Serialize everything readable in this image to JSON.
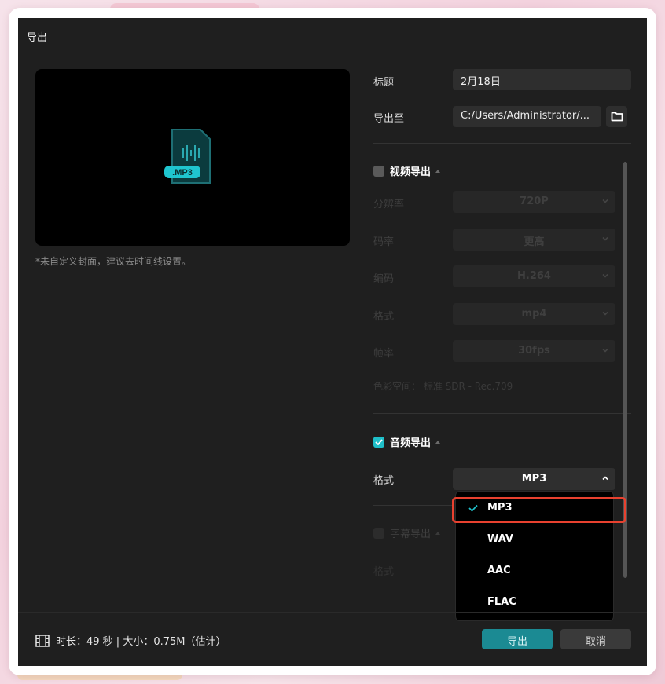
{
  "dialog": {
    "title": "导出"
  },
  "preview": {
    "file_badge": ".MP3",
    "cover_hint": "*未自定义封面，建议去时间线设置。"
  },
  "title_row": {
    "label": "标题",
    "value": "2月18日"
  },
  "export_to_row": {
    "label": "导出至",
    "value": "C:/Users/Administrator/..."
  },
  "video_export": {
    "title": "视频导出",
    "checked": false,
    "rows": [
      {
        "label": "分辨率",
        "value": "720P"
      },
      {
        "label": "码率",
        "value": "更高"
      },
      {
        "label": "编码",
        "value": "H.264"
      },
      {
        "label": "格式",
        "value": "mp4"
      },
      {
        "label": "帧率",
        "value": "30fps"
      }
    ],
    "color_space": "色彩空间：  标准 SDR - Rec.709"
  },
  "audio_export": {
    "title": "音频导出",
    "checked": true,
    "format_label": "格式",
    "format_value": "MP3"
  },
  "subtitle_export": {
    "title": "字幕导出",
    "checked": false,
    "format_label": "格式"
  },
  "format_dropdown": {
    "options": [
      "MP3",
      "WAV",
      "AAC",
      "FLAC"
    ],
    "selected": "MP3"
  },
  "footer": {
    "info": "时长：49 秒 | 大小：0.75M（估计）",
    "export_label": "导出",
    "cancel_label": "取消"
  },
  "colors": {
    "accent": "#1fbfc9",
    "export_button": "#1b8a93",
    "highlight": "#e8412f",
    "dialog_bg": "#1f1f1f"
  },
  "icons": {
    "file": "audio-file-icon",
    "folder": "folder-icon",
    "film": "film-icon",
    "check": "check-icon",
    "chevron": "chevron-down-icon"
  }
}
